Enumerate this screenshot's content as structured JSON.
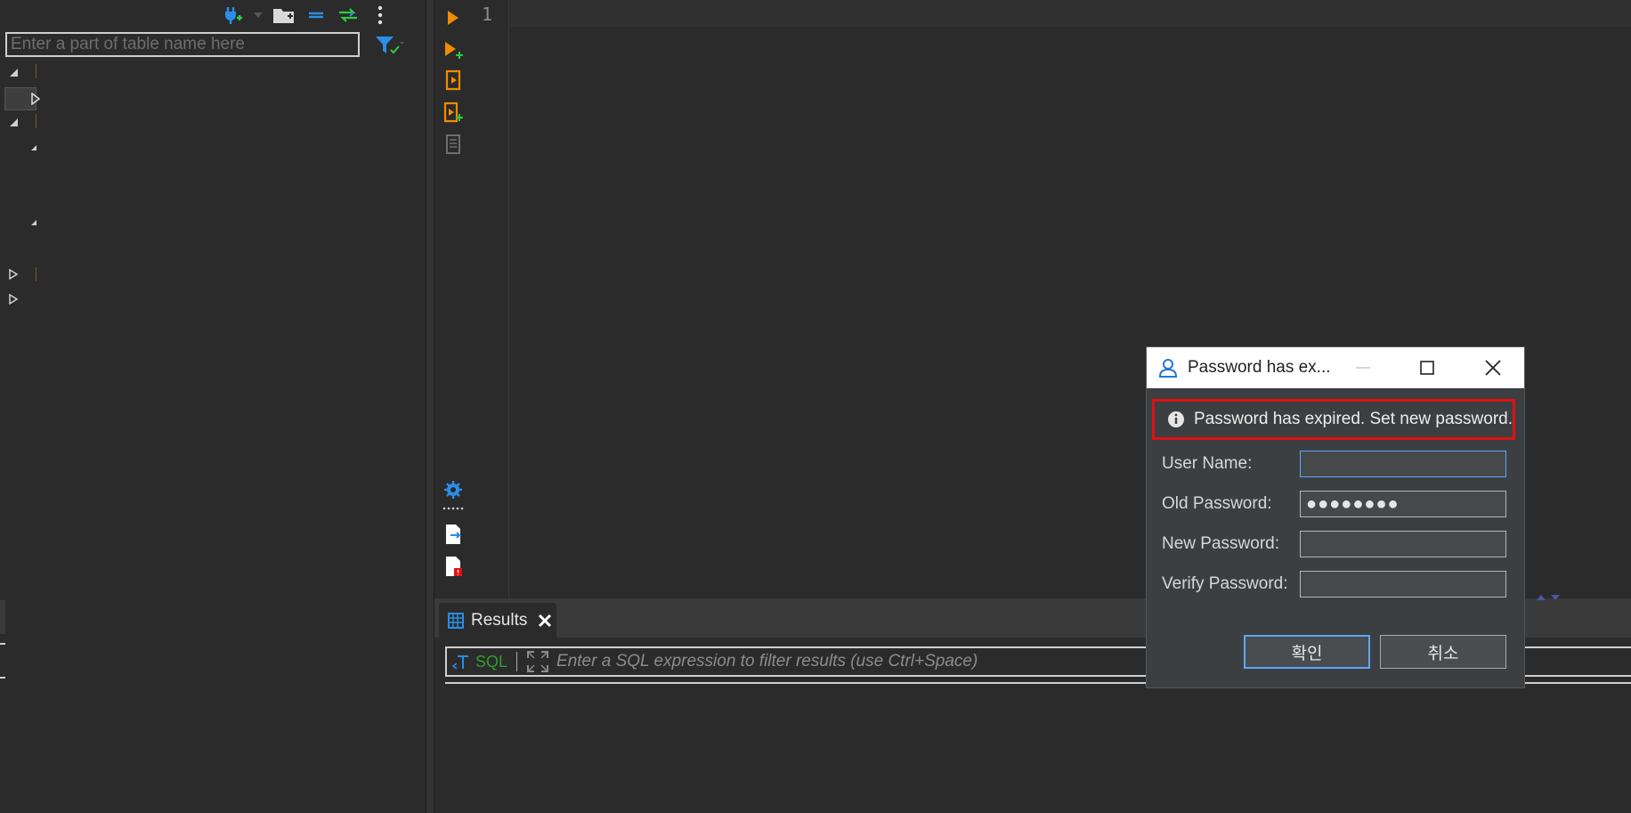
{
  "navigator": {
    "filter_placeholder": "Enter a part of table name here"
  },
  "editor": {
    "line_number": "1"
  },
  "results": {
    "tab_label": "Results",
    "filter_sql_label": "SQL",
    "filter_placeholder": "Enter a SQL expression to filter results (use Ctrl+Space)"
  },
  "dialog": {
    "title": "Password has ex...",
    "message": "Password has expired. Set new password.",
    "fields": {
      "user_name_label": "User Name:",
      "old_password_label": "Old Password:",
      "new_password_label": "New Password:",
      "verify_password_label": "Verify Password:",
      "old_password_mask": "●●●●●●●●"
    },
    "ok_label": "확인",
    "cancel_label": "취소"
  },
  "colors": {
    "background": "#2b2b2b",
    "accent_orange": "#f08c00",
    "accent_blue": "#2196f3",
    "highlight_red": "#e01010"
  }
}
